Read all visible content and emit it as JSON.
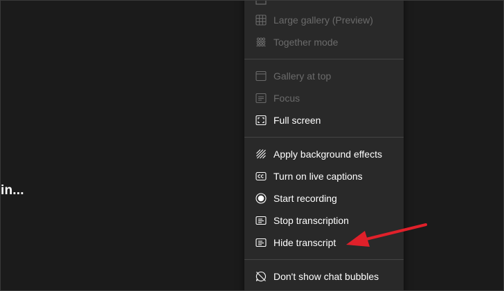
{
  "background": {
    "status_text": "in..."
  },
  "menu": {
    "items": [
      {
        "label": "Large gallery (Preview)",
        "icon": "large-gallery-icon",
        "enabled": false
      },
      {
        "label": "Together mode",
        "icon": "together-mode-icon",
        "enabled": false
      },
      {
        "label": "Gallery at top",
        "icon": "gallery-at-top-icon",
        "enabled": false
      },
      {
        "label": "Focus",
        "icon": "focus-icon",
        "enabled": false
      },
      {
        "label": "Full screen",
        "icon": "full-screen-icon",
        "enabled": true
      },
      {
        "label": "Apply background effects",
        "icon": "background-effects-icon",
        "enabled": true
      },
      {
        "label": "Turn on live captions",
        "icon": "captions-icon",
        "enabled": true
      },
      {
        "label": "Start recording",
        "icon": "record-icon",
        "enabled": true
      },
      {
        "label": "Stop transcription",
        "icon": "transcript-icon",
        "enabled": true
      },
      {
        "label": "Hide transcript",
        "icon": "transcript-icon",
        "enabled": true
      },
      {
        "label": "Don't show chat bubbles",
        "icon": "no-chat-bubbles-icon",
        "enabled": true
      }
    ]
  },
  "colors": {
    "background": "#1b1b1b",
    "menu_background": "#292929",
    "enabled_text": "#ffffff",
    "disabled_text": "#6b6b6b",
    "annotation_arrow": "#e0202a"
  }
}
